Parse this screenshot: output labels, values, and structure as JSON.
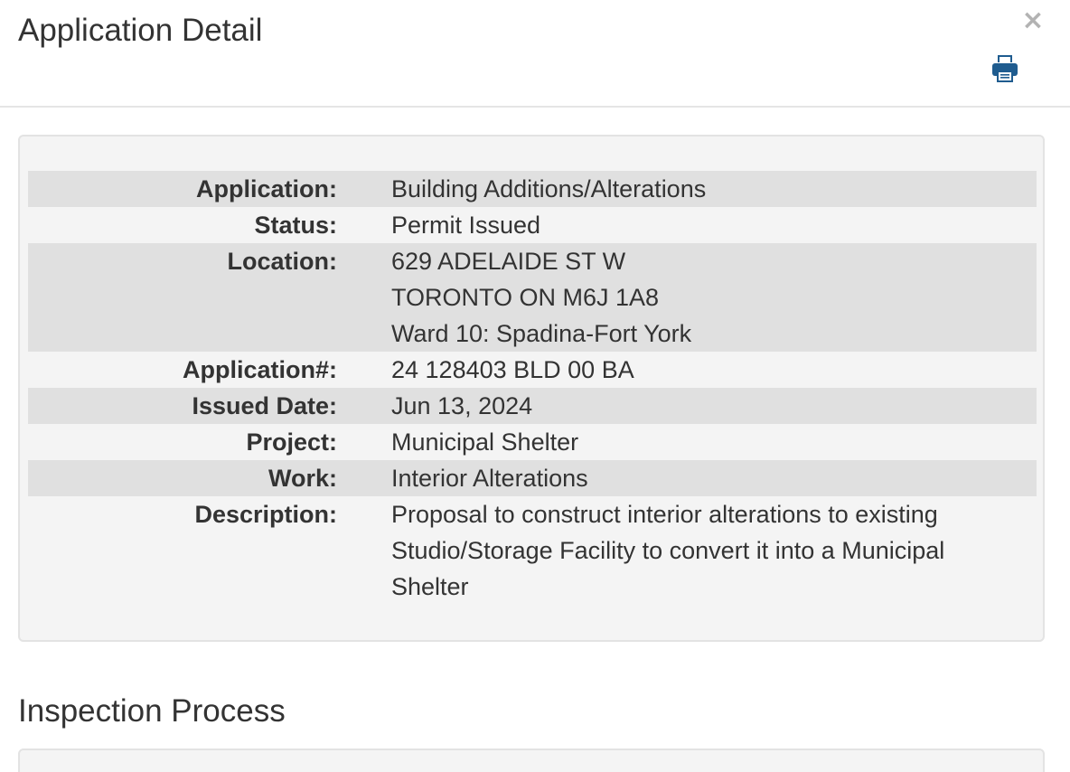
{
  "header": {
    "title": "Application Detail",
    "close_label": "×",
    "print_icon": "print-icon",
    "accent_color": "#1f5c8f"
  },
  "details": {
    "rows": [
      {
        "label": "Application:",
        "lines": [
          "Building Additions/Alterations"
        ]
      },
      {
        "label": "Status:",
        "lines": [
          "Permit Issued"
        ]
      },
      {
        "label": "Location:",
        "lines": [
          "629 ADELAIDE ST W",
          "TORONTO ON M6J 1A8",
          "Ward 10: Spadina-Fort York"
        ]
      },
      {
        "label": "Application#:",
        "lines": [
          "24 128403 BLD 00 BA"
        ]
      },
      {
        "label": "Issued Date:",
        "lines": [
          "Jun 13, 2024"
        ]
      },
      {
        "label": "Project:",
        "lines": [
          "Municipal Shelter"
        ]
      },
      {
        "label": "Work:",
        "lines": [
          "Interior Alterations"
        ]
      },
      {
        "label": "Description:",
        "lines": [
          "Proposal to construct interior alterations to existing",
          "Studio/Storage Facility to convert it into a Municipal",
          "Shelter"
        ]
      }
    ]
  },
  "inspection": {
    "title": "Inspection Process"
  }
}
